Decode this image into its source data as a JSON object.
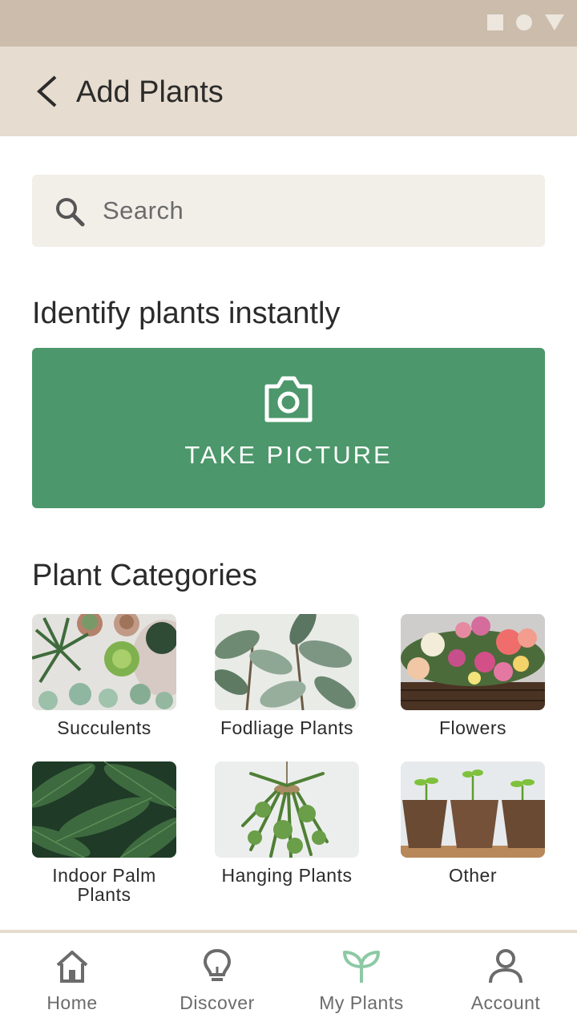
{
  "header": {
    "title": "Add Plants"
  },
  "search": {
    "placeholder": "Search"
  },
  "identify": {
    "heading": "Identify plants instantly",
    "button_label": "TAKE PICTURE"
  },
  "categories": {
    "heading": "Plant Categories",
    "items": [
      {
        "label": "Succulents"
      },
      {
        "label": "Fodliage Plants"
      },
      {
        "label": "Flowers"
      },
      {
        "label": "Indoor Palm Plants"
      },
      {
        "label": "Hanging Plants"
      },
      {
        "label": "Other"
      }
    ]
  },
  "nav": {
    "items": [
      {
        "label": "Home",
        "icon": "home-icon"
      },
      {
        "label": "Discover",
        "icon": "lightbulb-icon"
      },
      {
        "label": "My Plants",
        "icon": "sprout-icon"
      },
      {
        "label": "Account",
        "icon": "person-icon"
      }
    ],
    "active_index": 2
  },
  "colors": {
    "accent": "#4c976b",
    "app_bar": "#e6dccf",
    "status_bar": "#cbbcab",
    "search_bg": "#f2eee8"
  }
}
